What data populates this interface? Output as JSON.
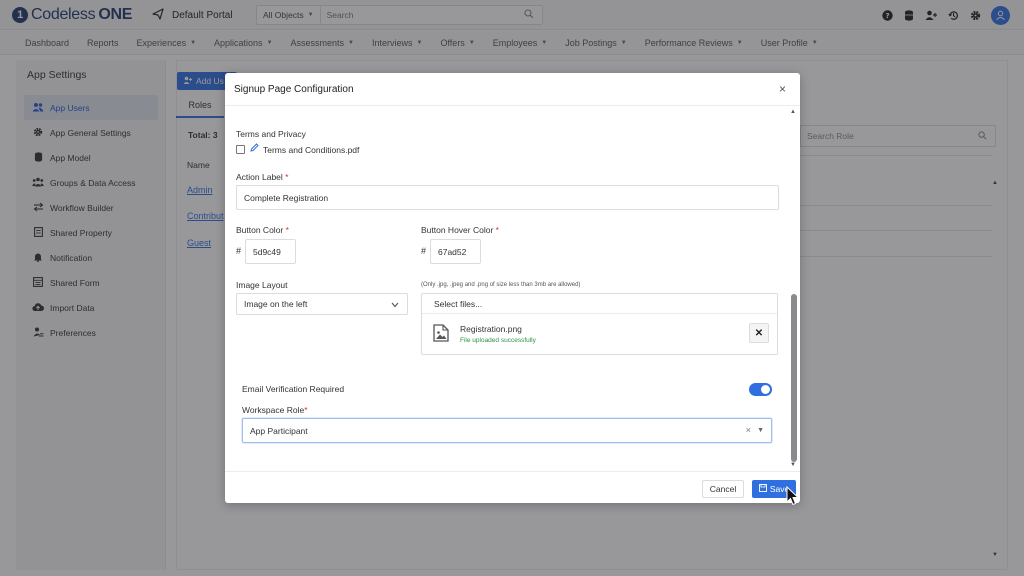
{
  "header": {
    "logo_prefix": "1",
    "logo_name": "Codeless",
    "logo_suffix": "ONE",
    "portal_name": "Default Portal",
    "search_scope": "All Objects",
    "search_placeholder": "Search"
  },
  "nav": {
    "items": [
      {
        "label": "Dashboard",
        "dropdown": false
      },
      {
        "label": "Reports",
        "dropdown": false
      },
      {
        "label": "Experiences",
        "dropdown": true
      },
      {
        "label": "Applications",
        "dropdown": true
      },
      {
        "label": "Assessments",
        "dropdown": true
      },
      {
        "label": "Interviews",
        "dropdown": true
      },
      {
        "label": "Offers",
        "dropdown": true
      },
      {
        "label": "Employees",
        "dropdown": true
      },
      {
        "label": "Job Postings",
        "dropdown": true
      },
      {
        "label": "Performance Reviews",
        "dropdown": true
      },
      {
        "label": "User Profile",
        "dropdown": true
      }
    ]
  },
  "sidebar": {
    "title": "App Settings",
    "items": [
      {
        "label": "App Users",
        "icon": "users-icon",
        "active": true
      },
      {
        "label": "App General Settings",
        "icon": "gear-icon",
        "active": false
      },
      {
        "label": "App Model",
        "icon": "database-icon",
        "active": false
      },
      {
        "label": "Groups & Data Access",
        "icon": "groups-icon",
        "active": false
      },
      {
        "label": "Workflow Builder",
        "icon": "workflow-icon",
        "active": false
      },
      {
        "label": "Shared Property",
        "icon": "file-icon",
        "active": false
      },
      {
        "label": "Notification",
        "icon": "bell-icon",
        "active": false
      },
      {
        "label": "Shared Form",
        "icon": "form-icon",
        "active": false
      },
      {
        "label": "Import Data",
        "icon": "cloud-upload-icon",
        "active": false
      },
      {
        "label": "Preferences",
        "icon": "preferences-icon",
        "active": false
      }
    ]
  },
  "background": {
    "add_user_label": "Add Us",
    "roles_tab": "Roles",
    "total": "Total: 3",
    "name_col": "Name",
    "rows": [
      "Admin",
      "Contribut",
      "Guest"
    ],
    "search_role_placeholder": "Search Role"
  },
  "modal": {
    "title": "Signup Page Configuration",
    "terms_label": "Terms and Privacy",
    "terms_file": "Terms and Conditions.pdf",
    "terms_checked": false,
    "action_label_label": "Action Label",
    "action_label_value": "Complete Registration",
    "button_color_label": "Button Color",
    "button_color_value": "5d9c49",
    "button_hover_label": "Button Hover Color",
    "button_hover_value": "67ad52",
    "image_layout_label": "Image Layout",
    "image_layout_value": "Image on the left",
    "file_hint": "(Only .jpg, .jpeg and .png of size less than 3mb are allowed)",
    "select_files": "Select files...",
    "uploaded_file": "Registration.png",
    "uploaded_status": "File uploaded successfully",
    "email_verification_label": "Email Verification Required",
    "email_verification_on": true,
    "workspace_role_label": "Workspace Role",
    "workspace_role_value": "App Participant",
    "cancel_label": "Cancel",
    "save_label": "Save"
  },
  "colors": {
    "accent": "#2f6fe0",
    "success": "#2b9348",
    "required": "#d93025"
  }
}
